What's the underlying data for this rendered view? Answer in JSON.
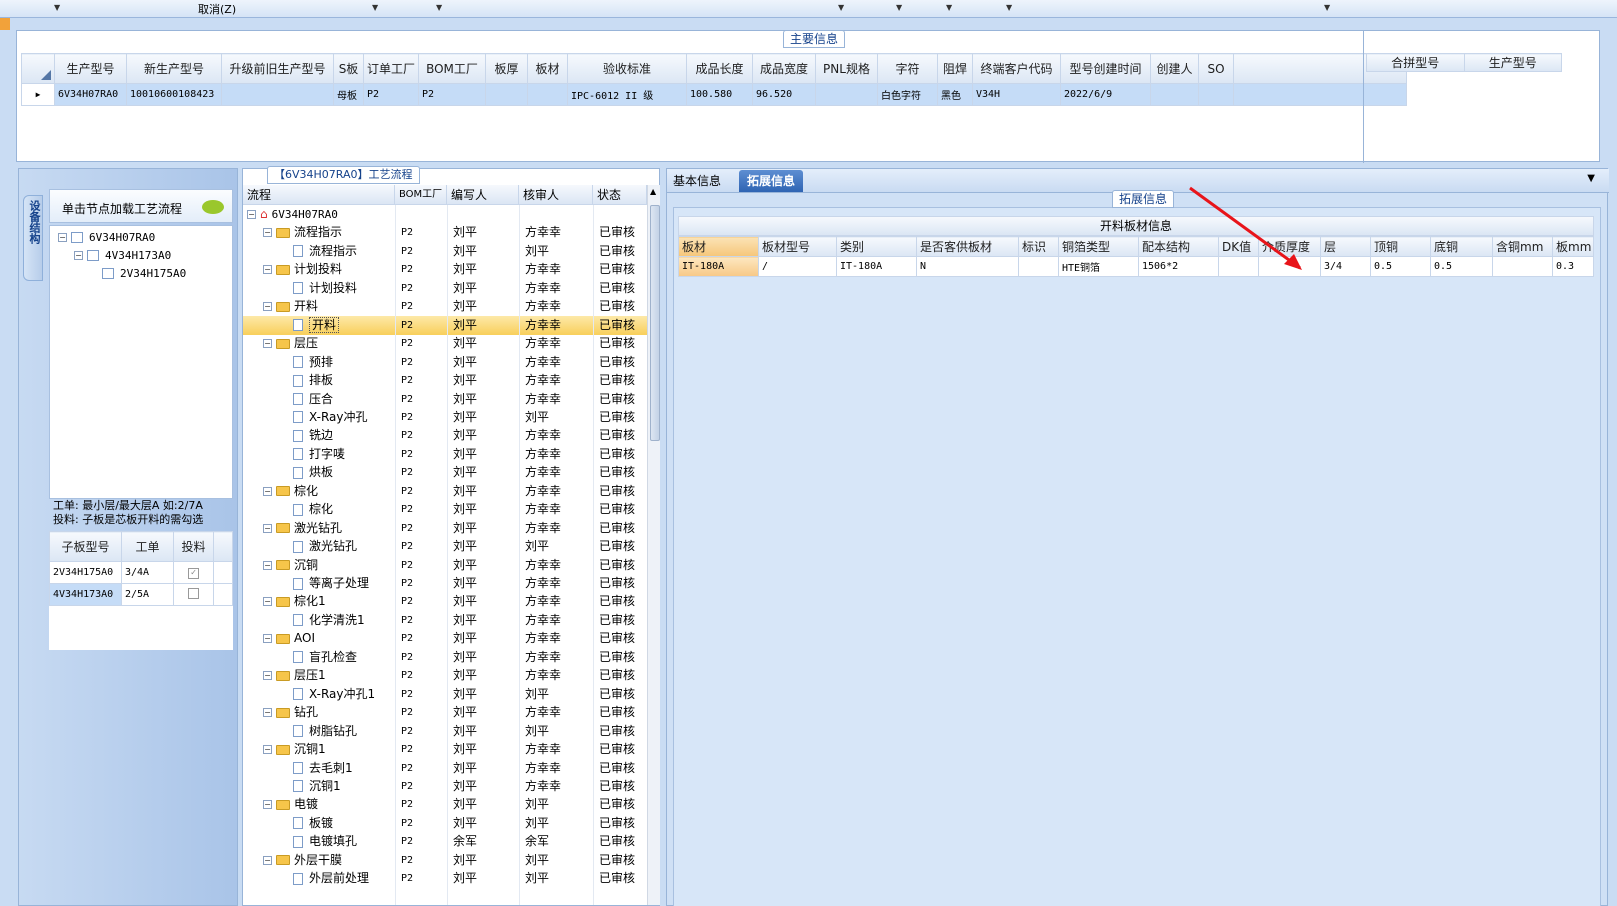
{
  "toolbar": {
    "cancel_label": "取消(Z)"
  },
  "main_info": {
    "section_title": "主要信息",
    "columns": [
      "生产型号",
      "新生产型号",
      "升级前旧生产型号",
      "S板",
      "订单工厂",
      "BOM工厂",
      "板厚",
      "板材",
      "验收标准",
      "成品长度",
      "成品宽度",
      "PNL规格",
      "字符",
      "阻焊",
      "终端客户代码",
      "型号创建时间",
      "创建人",
      "SO"
    ],
    "row": [
      "6V34H07RA0",
      "10010600108423",
      "",
      "母板",
      "P2",
      "P2",
      "",
      "",
      "IPC-6012 II 级",
      "100.580",
      "96.520",
      "",
      "白色字符",
      "黑色",
      "V34H",
      "2022/6/9",
      "",
      ""
    ],
    "side_columns": [
      "合拼型号",
      "生产型号"
    ]
  },
  "process_title": "【6V34H07RA0】工艺流程",
  "left": {
    "tab_label": "设备结构",
    "hint": "单击节点加载工艺流程",
    "tree": [
      "6V34H07RA0",
      "4V34H173A0",
      "2V34H175A0"
    ],
    "note_line1": "工单: 最小层/最大层A 如:2/7A",
    "note_line2": "投料: 子板是芯板开料的需勾选",
    "sub_columns": [
      "子板型号",
      "工单",
      "投料"
    ],
    "sub_rows": [
      {
        "model": "2V34H175A0",
        "order": "3/4A",
        "checked": true
      },
      {
        "model": "4V34H173A0",
        "order": "2/5A",
        "checked": false
      }
    ]
  },
  "flow": {
    "columns": [
      "流程",
      "BOM工厂",
      "编写人",
      "核审人",
      "状态"
    ],
    "root": "6V34H07RA0",
    "rows": [
      {
        "level": 1,
        "name": "流程指示",
        "bom": "P2",
        "writer": "刘平",
        "reviewer": "方幸幸",
        "status": "已审核"
      },
      {
        "level": 2,
        "name": "流程指示",
        "bom": "P2",
        "writer": "刘平",
        "reviewer": "刘平",
        "status": "已审核"
      },
      {
        "level": 1,
        "name": "计划投料",
        "bom": "P2",
        "writer": "刘平",
        "reviewer": "方幸幸",
        "status": "已审核"
      },
      {
        "level": 2,
        "name": "计划投料",
        "bom": "P2",
        "writer": "刘平",
        "reviewer": "方幸幸",
        "status": "已审核"
      },
      {
        "level": 1,
        "name": "开料",
        "bom": "P2",
        "writer": "刘平",
        "reviewer": "方幸幸",
        "status": "已审核"
      },
      {
        "level": 2,
        "name": "开料",
        "bom": "P2",
        "writer": "刘平",
        "reviewer": "方幸幸",
        "status": "已审核",
        "selected": true
      },
      {
        "level": 1,
        "name": "层压",
        "bom": "P2",
        "writer": "刘平",
        "reviewer": "方幸幸",
        "status": "已审核"
      },
      {
        "level": 2,
        "name": "预排",
        "bom": "P2",
        "writer": "刘平",
        "reviewer": "方幸幸",
        "status": "已审核"
      },
      {
        "level": 2,
        "name": "排板",
        "bom": "P2",
        "writer": "刘平",
        "reviewer": "方幸幸",
        "status": "已审核"
      },
      {
        "level": 2,
        "name": "压合",
        "bom": "P2",
        "writer": "刘平",
        "reviewer": "方幸幸",
        "status": "已审核"
      },
      {
        "level": 2,
        "name": "X-Ray冲孔",
        "bom": "P2",
        "writer": "刘平",
        "reviewer": "刘平",
        "status": "已审核"
      },
      {
        "level": 2,
        "name": "铣边",
        "bom": "P2",
        "writer": "刘平",
        "reviewer": "方幸幸",
        "status": "已审核"
      },
      {
        "level": 2,
        "name": "打字唛",
        "bom": "P2",
        "writer": "刘平",
        "reviewer": "方幸幸",
        "status": "已审核"
      },
      {
        "level": 2,
        "name": "烘板",
        "bom": "P2",
        "writer": "刘平",
        "reviewer": "方幸幸",
        "status": "已审核"
      },
      {
        "level": 1,
        "name": "棕化",
        "bom": "P2",
        "writer": "刘平",
        "reviewer": "方幸幸",
        "status": "已审核"
      },
      {
        "level": 2,
        "name": "棕化",
        "bom": "P2",
        "writer": "刘平",
        "reviewer": "方幸幸",
        "status": "已审核"
      },
      {
        "level": 1,
        "name": "激光钻孔",
        "bom": "P2",
        "writer": "刘平",
        "reviewer": "方幸幸",
        "status": "已审核"
      },
      {
        "level": 2,
        "name": "激光钻孔",
        "bom": "P2",
        "writer": "刘平",
        "reviewer": "刘平",
        "status": "已审核"
      },
      {
        "level": 1,
        "name": "沉铜",
        "bom": "P2",
        "writer": "刘平",
        "reviewer": "方幸幸",
        "status": "已审核"
      },
      {
        "level": 2,
        "name": "等离子处理",
        "bom": "P2",
        "writer": "刘平",
        "reviewer": "方幸幸",
        "status": "已审核"
      },
      {
        "level": 1,
        "name": "棕化1",
        "bom": "P2",
        "writer": "刘平",
        "reviewer": "方幸幸",
        "status": "已审核"
      },
      {
        "level": 2,
        "name": "化学清洗1",
        "bom": "P2",
        "writer": "刘平",
        "reviewer": "方幸幸",
        "status": "已审核"
      },
      {
        "level": 1,
        "name": "AOI",
        "bom": "P2",
        "writer": "刘平",
        "reviewer": "方幸幸",
        "status": "已审核"
      },
      {
        "level": 2,
        "name": "盲孔检查",
        "bom": "P2",
        "writer": "刘平",
        "reviewer": "方幸幸",
        "status": "已审核"
      },
      {
        "level": 1,
        "name": "层压1",
        "bom": "P2",
        "writer": "刘平",
        "reviewer": "方幸幸",
        "status": "已审核"
      },
      {
        "level": 2,
        "name": "X-Ray冲孔1",
        "bom": "P2",
        "writer": "刘平",
        "reviewer": "刘平",
        "status": "已审核"
      },
      {
        "level": 1,
        "name": "钻孔",
        "bom": "P2",
        "writer": "刘平",
        "reviewer": "方幸幸",
        "status": "已审核"
      },
      {
        "level": 2,
        "name": "树脂钻孔",
        "bom": "P2",
        "writer": "刘平",
        "reviewer": "刘平",
        "status": "已审核"
      },
      {
        "level": 1,
        "name": "沉铜1",
        "bom": "P2",
        "writer": "刘平",
        "reviewer": "方幸幸",
        "status": "已审核"
      },
      {
        "level": 2,
        "name": "去毛刺1",
        "bom": "P2",
        "writer": "刘平",
        "reviewer": "方幸幸",
        "status": "已审核"
      },
      {
        "level": 2,
        "name": "沉铜1",
        "bom": "P2",
        "writer": "刘平",
        "reviewer": "方幸幸",
        "status": "已审核"
      },
      {
        "level": 1,
        "name": "电镀",
        "bom": "P2",
        "writer": "刘平",
        "reviewer": "刘平",
        "status": "已审核"
      },
      {
        "level": 2,
        "name": "板镀",
        "bom": "P2",
        "writer": "刘平",
        "reviewer": "刘平",
        "status": "已审核"
      },
      {
        "level": 2,
        "name": "电镀填孔",
        "bom": "P2",
        "writer": "余军",
        "reviewer": "余军",
        "status": "已审核"
      },
      {
        "level": 1,
        "name": "外层干膜",
        "bom": "P2",
        "writer": "刘平",
        "reviewer": "刘平",
        "status": "已审核"
      },
      {
        "level": 2,
        "name": "外层前处理",
        "bom": "P2",
        "writer": "刘平",
        "reviewer": "刘平",
        "status": "已审核"
      }
    ]
  },
  "right": {
    "tabs": [
      "基本信息",
      "拓展信息"
    ],
    "active_tab": 1,
    "section_title": "拓展信息",
    "table_title": "开料板材信息",
    "columns": [
      "板材",
      "板材型号",
      "类别",
      "是否客供板材",
      "标识",
      "铜箔类型",
      "配本结构",
      "DK值",
      "介质厚度",
      "层",
      "顶铜",
      "底铜",
      "含铜mm",
      "板mm"
    ],
    "row": [
      "IT-180A",
      "/",
      "IT-180A",
      "N",
      "",
      "HTE铜箔",
      "1506*2",
      "",
      "",
      "3/4",
      "0.5",
      "0.5",
      "",
      "0.3"
    ],
    "arrow_color": "#e8141a"
  }
}
